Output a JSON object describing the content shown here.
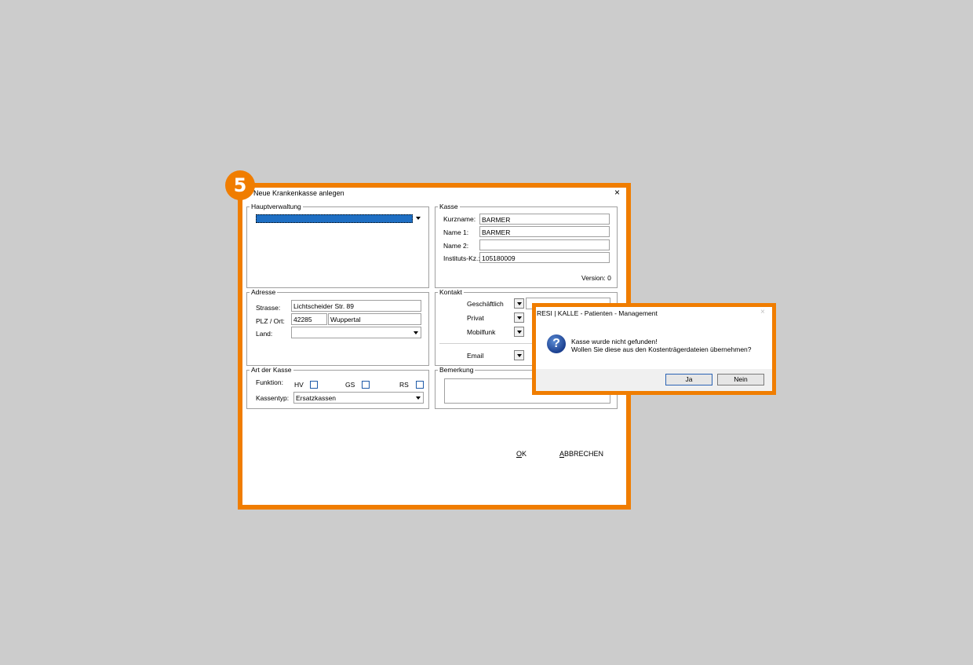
{
  "step_number": "5",
  "window": {
    "title": "Neue Krankenkasse anlegen",
    "close_icon": "×"
  },
  "hauptverwaltung": {
    "label": "Hauptverwaltung"
  },
  "kasse": {
    "label": "Kasse",
    "kurzname_label": "Kurzname:",
    "kurzname_value": "BARMER",
    "name1_label": "Name 1:",
    "name1_value": "BARMER",
    "name2_label": "Name 2:",
    "name2_value": "",
    "instituts_label": "Instituts-Kz.:",
    "instituts_value": "105180009",
    "version": "Version: 0"
  },
  "adresse": {
    "label": "Adresse",
    "strasse_label": "Strasse:",
    "strasse_value": "Lichtscheider Str. 89",
    "plz_label": "PLZ / Ort:",
    "plz_value": "42285",
    "ort_value": "Wuppertal",
    "land_label": "Land:",
    "land_value": ""
  },
  "kontakt": {
    "label": "Kontakt",
    "geschaeftlich_label": "Geschäftlich",
    "privat_label": "Privat",
    "mobilfunk_label": "Mobilfunk",
    "email_label": "Email"
  },
  "art": {
    "label": "Art der Kasse",
    "funktion_label": "Funktion:",
    "hv_label": "HV",
    "gs_label": "GS",
    "rs_label": "RS",
    "kassentyp_label": "Kassentyp:",
    "kassentyp_value": "Ersatzkassen"
  },
  "bemerkung": {
    "label": "Bemerkung"
  },
  "actions": {
    "ok_accel": "O",
    "ok_rest": "K",
    "abbrechen_accel": "A",
    "abbrechen_rest": "BBRECHEN"
  },
  "message_box": {
    "title": "RESI | KALLE - Patienten - Management",
    "close_icon": "×",
    "line1": "Kasse wurde nicht gefunden!",
    "line2": "Wollen Sie diese aus den Kostenträgerdateien übernehmen?",
    "icon_glyph": "?",
    "yes_label": "Ja",
    "no_label": "Nein"
  },
  "colors": {
    "accent": "#f07d00",
    "selection": "#1e6fc4",
    "background": "#cccccc"
  }
}
